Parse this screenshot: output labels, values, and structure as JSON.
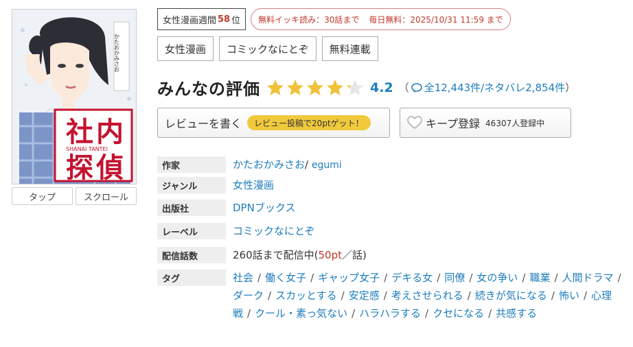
{
  "cover": {
    "title_kanji": [
      "社",
      "内",
      "探",
      "偵"
    ],
    "title_romaji": "SHANAI TANTEI",
    "vertical_text": "かたおかみさお"
  },
  "read_buttons": [
    "タップ",
    "スクロール"
  ],
  "ranking": {
    "label": "女性漫画週間",
    "rank": "58",
    "suffix": "位"
  },
  "free_info": {
    "text1": "無料イッキ読み：30話まで",
    "text2": "毎日無料：2025/10/31 11:59 まで"
  },
  "categories": [
    "女性漫画",
    "コミックなにとぞ",
    "無料連載"
  ],
  "rating": {
    "title": "みんなの評価",
    "stars": 4.2,
    "score": "4.2",
    "open_paren": "（",
    "count_text": "全12,443件/ネタバレ2,854件",
    "close_paren": "）",
    "star_color": "#f0c23b"
  },
  "actions": {
    "review_label": "レビューを書く",
    "review_bonus": "レビュー投稿で20ptゲット！",
    "keep_label": "キープ登録",
    "keep_count": "46307人登録中"
  },
  "details": {
    "author_key": "作家",
    "author1": "かたおかみさお",
    "author_sep": "/",
    "author2": "egumi",
    "genre_key": "ジャンル",
    "genre": "女性漫画",
    "publisher_key": "出版社",
    "publisher": "DPNブックス",
    "label_key": "レーベル",
    "label": "コミックなにとぞ",
    "episodes_key": "配信話数",
    "episodes_text": "260話まで配信中(",
    "episodes_pt": "50pt",
    "episodes_tail": "／話)",
    "tags_key": "タグ",
    "tags": [
      "社会",
      "働く女子",
      "ギャップ女子",
      "デキる女",
      "同僚",
      "女の争い",
      "職業",
      "人間ドラマ",
      "ダーク",
      "スカッとする",
      "安定感",
      "考えさせられる",
      "続きが気になる",
      "怖い",
      "心理戦",
      "クール・素っ気ない",
      "ハラハラする",
      "クセになる",
      "共感する"
    ]
  },
  "colors": {
    "link": "#1e7dbd",
    "accent_red": "#c0392b",
    "bonus_yellow": "#f0c93c"
  }
}
